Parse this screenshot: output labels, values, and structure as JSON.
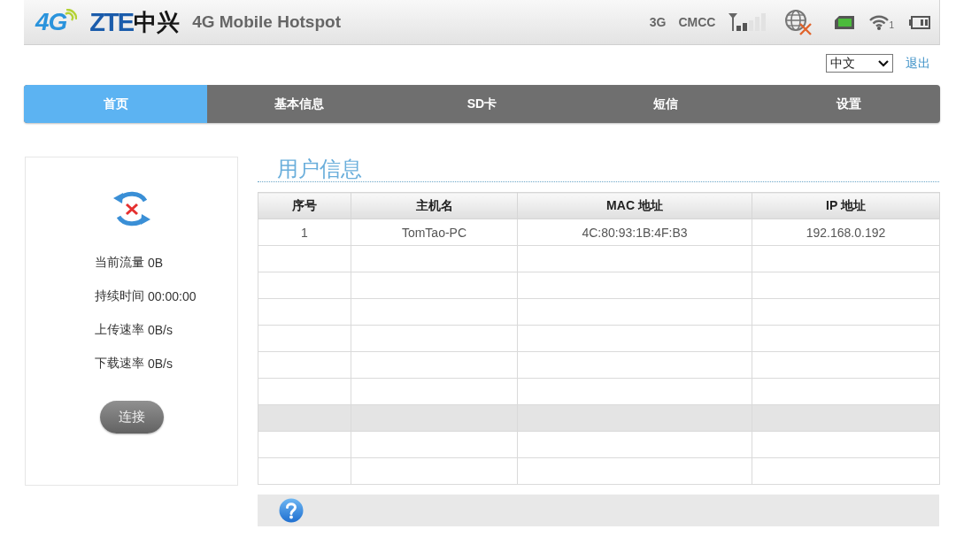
{
  "header": {
    "logo_badge": "4G",
    "brand": "ZTE",
    "brand_cn": "中兴",
    "product": "4G Mobile Hotspot",
    "network_type": "3G",
    "carrier": "CMCC",
    "wifi_clients": "1"
  },
  "top_links": {
    "language": "中文",
    "logout": "退出"
  },
  "nav": [
    {
      "label": "首页",
      "selected": true
    },
    {
      "label": "基本信息",
      "selected": false
    },
    {
      "label": "SD卡",
      "selected": false
    },
    {
      "label": "短信",
      "selected": false
    },
    {
      "label": "设置",
      "selected": false
    }
  ],
  "status_panel": {
    "stats": [
      {
        "label": "当前流量",
        "value": "0B"
      },
      {
        "label": "持续时间",
        "value": "00:00:00"
      },
      {
        "label": "上传速率",
        "value": "0B/s"
      },
      {
        "label": "下载速率",
        "value": "0B/s"
      }
    ],
    "connect_button": "连接"
  },
  "users": {
    "title": "用户信息",
    "columns": [
      "序号",
      "主机名",
      "MAC 地址",
      "IP 地址"
    ],
    "rows": [
      {
        "cells": [
          "1",
          "TomTao-PC",
          "4C:80:93:1B:4F:B3",
          "192.168.0.192"
        ],
        "selected": false
      },
      {
        "selected": false
      },
      {
        "selected": false
      },
      {
        "selected": false
      },
      {
        "selected": false
      },
      {
        "selected": false
      },
      {
        "selected": false
      },
      {
        "selected": true
      },
      {
        "selected": false
      },
      {
        "selected": false
      }
    ]
  }
}
